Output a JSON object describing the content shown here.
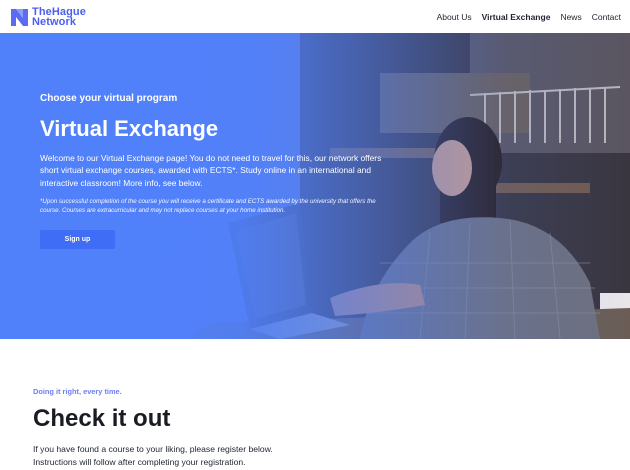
{
  "header": {
    "logo": {
      "line1": "TheHague",
      "line2": "Network"
    },
    "nav": [
      {
        "label": "About Us",
        "active": false
      },
      {
        "label": "Virtual Exchange",
        "active": true
      },
      {
        "label": "News",
        "active": false
      },
      {
        "label": "Contact",
        "active": false
      }
    ]
  },
  "hero": {
    "eyebrow": "Choose your virtual program",
    "title": "Virtual Exchange",
    "description": "Welcome to our Virtual Exchange page! You do not need to travel for this, our network offers short virtual exchange courses, awarded with ECTS*. Study online in an international and interactive classroom! More info, see below.",
    "note": "*Upon successful completion of the course you will receive a certificate and ECTS awarded by the university that offers the course. Courses are extracurricular and may not replace courses at your home institution.",
    "signup_label": "Sign up"
  },
  "section": {
    "kicker": "Doing it right, every time.",
    "title": "Check it out",
    "line1": "If you have found a course to your liking, please register below.",
    "line2": "Instructions will follow after completing your registration."
  },
  "colors": {
    "brand": "#4a5ef0",
    "hero_overlay": "#5080fa",
    "button": "#3f6df6",
    "kicker": "#6e7cf2"
  }
}
